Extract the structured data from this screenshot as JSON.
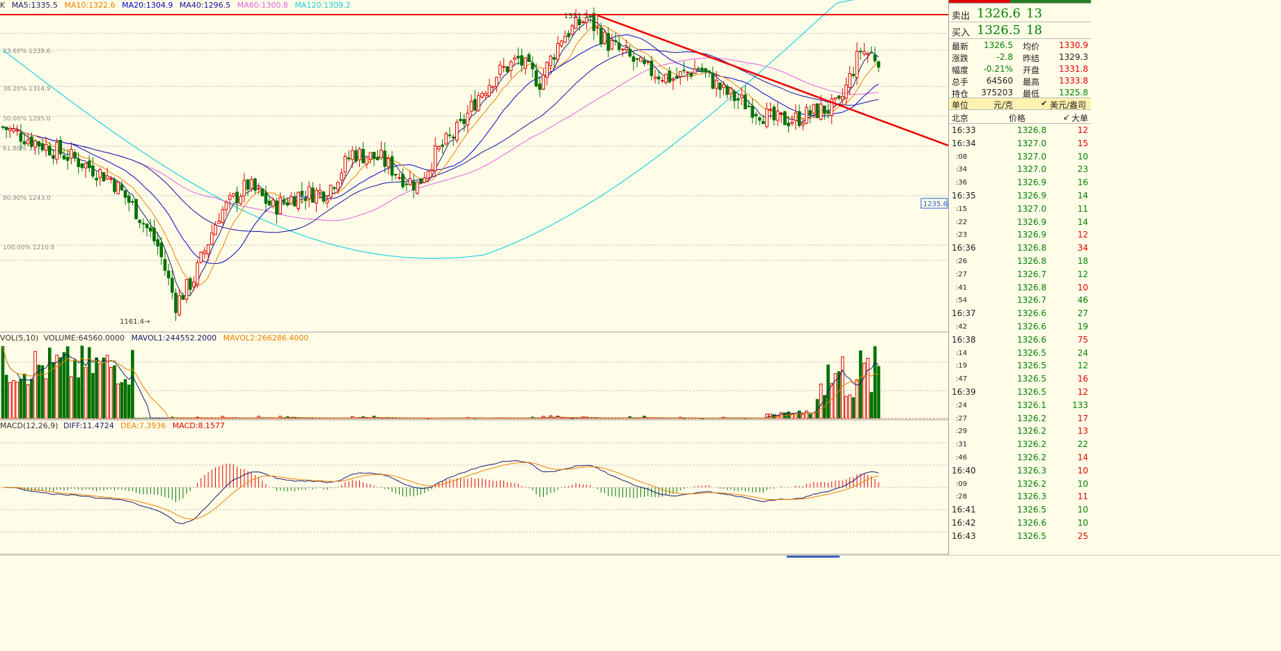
{
  "legend": {
    "k_label": "K",
    "ma5": "MA5:1335.5",
    "ma10": "MA10:1322.6",
    "ma20": "MA20:1304.9",
    "ma40": "MA40:1296.5",
    "ma60": "MA60:1300.8",
    "ma120": "MA120:1309.2",
    "vol": "VOL(5,10)",
    "volume": "VOLUME:64560.0000",
    "mavol1": "MAVOL1:244552.2000",
    "mavol2": "MAVOL2:266286.4000",
    "macd": "MACD(12,26,9)",
    "diff": "DIFF:11.4724",
    "dea": "DEA:7.3936",
    "macd_val": "MACD:8.1577"
  },
  "colors": {
    "ma5": "#1a1a6e",
    "ma10": "#f08000",
    "ma20": "#0000cc",
    "ma40": "#1010a0",
    "ma60": "#e060e0",
    "ma120": "#20d0e0",
    "up": "#e00000",
    "down": "#007000",
    "trendline": "#ee0000",
    "price_text": "#008000"
  },
  "fib_labels": [
    "23.60% 1339.6",
    "38.20% 1314.9",
    "50.00% 1295.0",
    "61.80% 1275.2",
    "80.90% 1243.0",
    "100.00% 1210.8"
  ],
  "price_tags": {
    "high_tag": "1331.5",
    "low_tag": "1161.4",
    "last_box": "1235.6"
  },
  "quote": {
    "sell_label": "卖出",
    "sell_price": "1326.6",
    "sell_qty": "13",
    "buy_label": "买入",
    "buy_price": "1326.5",
    "buy_qty": "18",
    "stats": [
      {
        "l1": "最新",
        "v1": "1326.5",
        "c1": "g",
        "l2": "均价",
        "v2": "1330.9",
        "c2": "r"
      },
      {
        "l1": "涨跌",
        "v1": "-2.8",
        "c1": "g",
        "l2": "昨结",
        "v2": "1329.3",
        "c2": "k"
      },
      {
        "l1": "幅度",
        "v1": "-0.21%",
        "c1": "g",
        "l2": "开盘",
        "v2": "1331.8",
        "c2": "r"
      },
      {
        "l1": "总手",
        "v1": "64560",
        "c1": "k",
        "l2": "最高",
        "v2": "1333.8",
        "c2": "r"
      },
      {
        "l1": "持仓",
        "v1": "375203",
        "c1": "k",
        "l2": "最低",
        "v2": "1325.8",
        "c2": "g"
      }
    ],
    "unit_label": "单位",
    "unit_value": "元/克",
    "unit_alt": "美元/盎司",
    "tick_header": {
      "time": "北京",
      "price": "价格",
      "qty": "大单"
    }
  },
  "ticks": [
    {
      "t": "16:33",
      "p": "1326.8",
      "q": "12",
      "qc": "r",
      "major": true
    },
    {
      "t": "16:34",
      "p": "1327.0",
      "q": "15",
      "qc": "r",
      "major": true
    },
    {
      "t": ":08",
      "p": "1327.0",
      "q": "10",
      "qc": "g",
      "major": false
    },
    {
      "t": ":34",
      "p": "1327.0",
      "q": "23",
      "qc": "g",
      "major": false
    },
    {
      "t": ":36",
      "p": "1326.9",
      "q": "16",
      "qc": "g",
      "major": false
    },
    {
      "t": "16:35",
      "p": "1326.9",
      "q": "14",
      "qc": "g",
      "major": true
    },
    {
      "t": ":15",
      "p": "1327.0",
      "q": "11",
      "qc": "g",
      "major": false
    },
    {
      "t": ":22",
      "p": "1326.9",
      "q": "14",
      "qc": "g",
      "major": false
    },
    {
      "t": ":23",
      "p": "1326.9",
      "q": "12",
      "qc": "r",
      "major": false
    },
    {
      "t": "16:36",
      "p": "1326.8",
      "q": "34",
      "qc": "r",
      "major": true
    },
    {
      "t": ":26",
      "p": "1326.8",
      "q": "18",
      "qc": "g",
      "major": false
    },
    {
      "t": ":27",
      "p": "1326.7",
      "q": "12",
      "qc": "g",
      "major": false
    },
    {
      "t": ":41",
      "p": "1326.8",
      "q": "10",
      "qc": "r",
      "major": false
    },
    {
      "t": ":54",
      "p": "1326.7",
      "q": "46",
      "qc": "g",
      "major": false
    },
    {
      "t": "16:37",
      "p": "1326.6",
      "q": "27",
      "qc": "g",
      "major": true
    },
    {
      "t": ":42",
      "p": "1326.6",
      "q": "19",
      "qc": "g",
      "major": false
    },
    {
      "t": "16:38",
      "p": "1326.6",
      "q": "75",
      "qc": "r",
      "major": true
    },
    {
      "t": ":14",
      "p": "1326.5",
      "q": "24",
      "qc": "g",
      "major": false
    },
    {
      "t": ":19",
      "p": "1326.5",
      "q": "12",
      "qc": "g",
      "major": false
    },
    {
      "t": ":47",
      "p": "1326.5",
      "q": "16",
      "qc": "r",
      "major": false
    },
    {
      "t": "16:39",
      "p": "1326.5",
      "q": "12",
      "qc": "r",
      "major": true
    },
    {
      "t": ":24",
      "p": "1326.1",
      "q": "133",
      "qc": "g",
      "major": false
    },
    {
      "t": ":27",
      "p": "1326.2",
      "q": "17",
      "qc": "r",
      "major": false
    },
    {
      "t": ":29",
      "p": "1326.2",
      "q": "13",
      "qc": "r",
      "major": false
    },
    {
      "t": ":31",
      "p": "1326.2",
      "q": "22",
      "qc": "g",
      "major": false
    },
    {
      "t": ":46",
      "p": "1326.2",
      "q": "14",
      "qc": "r",
      "major": false
    },
    {
      "t": "16:40",
      "p": "1326.3",
      "q": "10",
      "qc": "r",
      "major": true
    },
    {
      "t": ":09",
      "p": "1326.2",
      "q": "10",
      "qc": "g",
      "major": false
    },
    {
      "t": ":28",
      "p": "1326.3",
      "q": "11",
      "qc": "r",
      "major": false
    },
    {
      "t": "16:41",
      "p": "1326.5",
      "q": "10",
      "qc": "g",
      "major": true
    },
    {
      "t": "16:42",
      "p": "1326.6",
      "q": "10",
      "qc": "g",
      "major": true
    },
    {
      "t": "16:43",
      "p": "1326.5",
      "q": "25",
      "qc": "r",
      "major": true
    }
  ]
}
